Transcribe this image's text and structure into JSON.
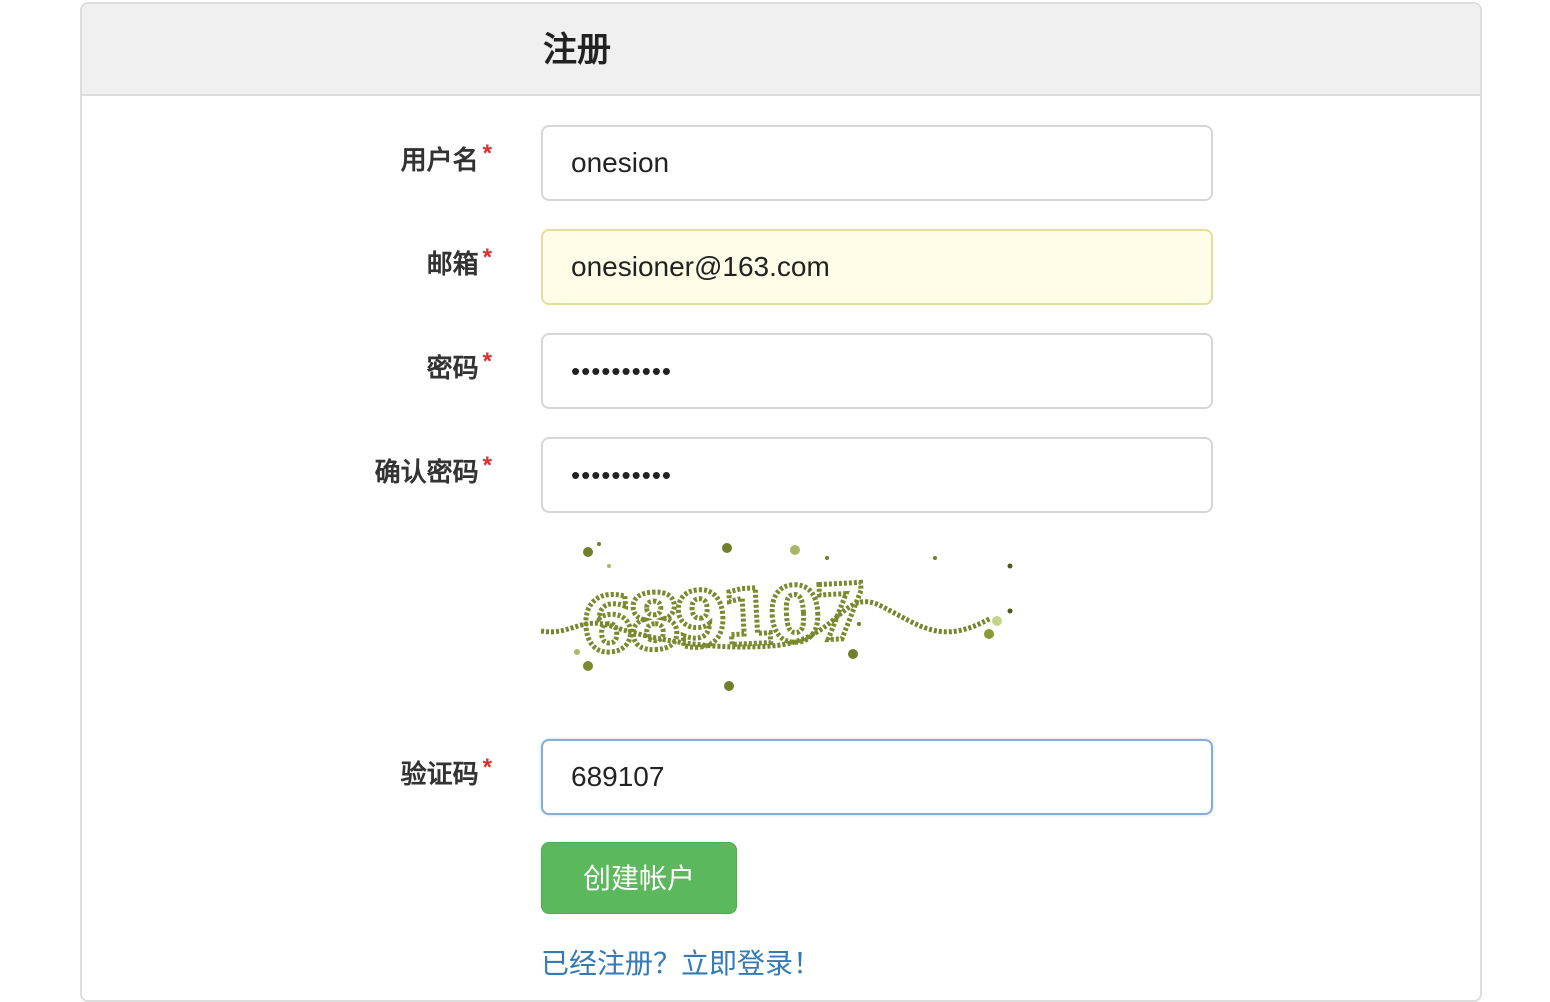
{
  "header": {
    "title": "注册"
  },
  "form": {
    "username": {
      "label": "用户名",
      "required_mark": "*",
      "value": "onesion"
    },
    "email": {
      "label": "邮箱",
      "required_mark": "*",
      "value": "onesioner@163.com"
    },
    "password": {
      "label": "密码",
      "required_mark": "*",
      "value": "••••••••••"
    },
    "confirm_password": {
      "label": "确认密码",
      "required_mark": "*",
      "value": "••••••••••"
    },
    "captcha_image": {
      "text": "689107",
      "color": "#7a8a2e"
    },
    "captcha": {
      "label": "验证码",
      "required_mark": "*",
      "value": "689107"
    }
  },
  "actions": {
    "submit_label": "创建帐户",
    "login_link": "已经注册？立即登录！"
  },
  "colors": {
    "submit_bg": "#5cb85c",
    "link": "#337ab7",
    "required": "#d9302c"
  }
}
